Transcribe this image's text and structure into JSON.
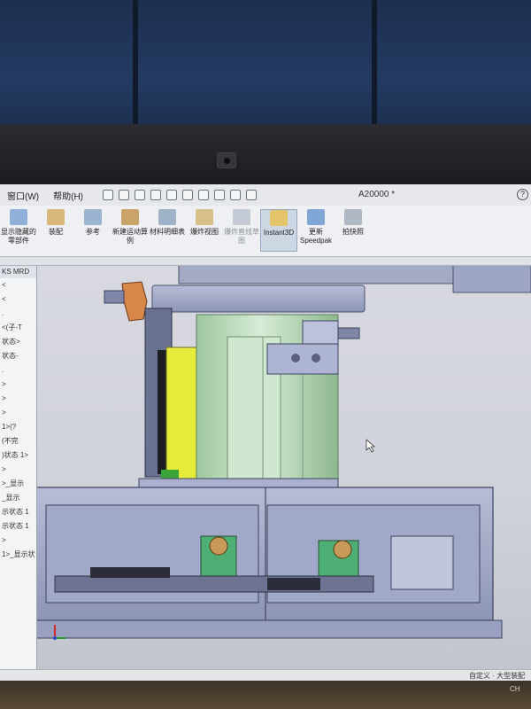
{
  "menubar": {
    "items": [
      "窗口(W)",
      "帮助(H)"
    ],
    "document_title": "A20000 *",
    "help_icon": "?"
  },
  "ribbon": {
    "buttons": [
      {
        "label": "显示隐藏的零部件",
        "icon": "eye-icon"
      },
      {
        "label": "装配",
        "icon": "assembly-icon"
      },
      {
        "label": "参考",
        "icon": "reference-geometry-icon"
      },
      {
        "label": "新建运动算例",
        "icon": "motion-study-icon"
      },
      {
        "label": "材料明细表",
        "icon": "bom-icon"
      },
      {
        "label": "爆炸视图",
        "icon": "exploded-view-icon"
      },
      {
        "label": "爆炸直线草图",
        "icon": "explode-line-sketch-icon"
      },
      {
        "label": "Instant3D",
        "icon": "instant3d-icon"
      },
      {
        "label": "更新 Speedpak",
        "icon": "speedpak-icon"
      },
      {
        "label": "拍快照",
        "icon": "snapshot-icon"
      }
    ]
  },
  "tree": {
    "header": "KS MRD",
    "items": [
      "<",
      "<",
      ".",
      "<(子-T",
      "状态>",
      "状态-",
      ".",
      ">",
      ">",
      ">",
      "1>(?",
      "(不完",
      ")状态 1>",
      ">",
      ">_显示",
      "_显示",
      "示状态 1",
      "示状态 1",
      ">",
      "1>_显示状"
    ]
  },
  "statusbar": {
    "text": "自定义 · 大型装配体"
  },
  "taskbar": {
    "tray_text": "CH"
  },
  "colors": {
    "accent": "#cdd6e3",
    "model_grey": "#9aa3c4",
    "model_green": "#bfe0bf",
    "highlight_yellow": "#e8e83a"
  }
}
